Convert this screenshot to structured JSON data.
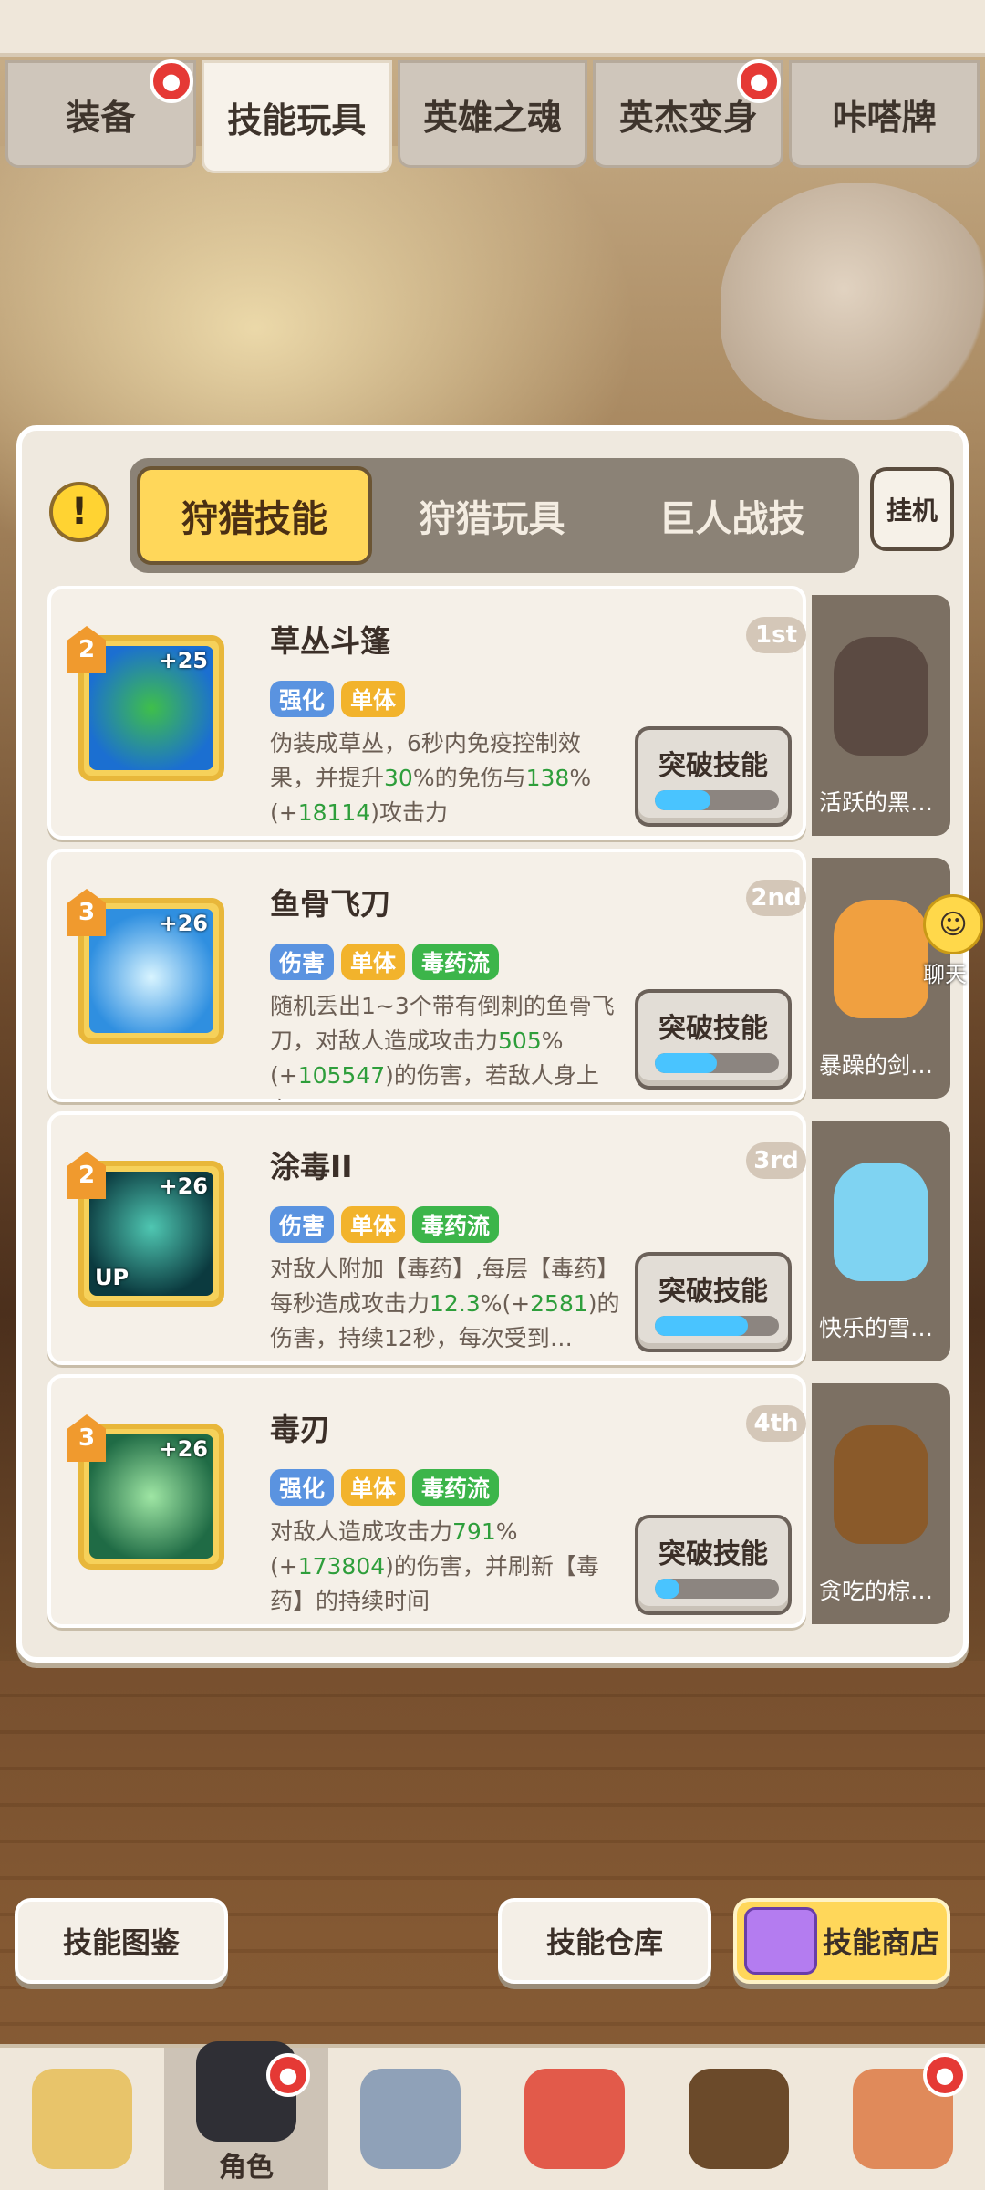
{
  "top_tabs": [
    {
      "label": "装备",
      "badge": true
    },
    {
      "label": "技能玩具",
      "badge": false,
      "active": true
    },
    {
      "label": "英雄之魂",
      "badge": false
    },
    {
      "label": "英杰变身",
      "badge": true
    },
    {
      "label": "咔嗒牌",
      "badge": false
    }
  ],
  "sub_tabs": [
    {
      "label": "狩猎技能",
      "active": true
    },
    {
      "label": "狩猎玩具"
    },
    {
      "label": "巨人战技"
    }
  ],
  "idle_label": "挂机",
  "info_symbol": "!",
  "break_label": "突破技能",
  "skills": [
    {
      "name": "草丛斗篷",
      "rank": "1st",
      "level": "2",
      "plus": "+25",
      "up": "",
      "icon": "bush-icon",
      "tags": [
        {
          "text": "强化",
          "color": "blue"
        },
        {
          "text": "单体",
          "color": "gold"
        }
      ],
      "desc_parts": [
        "伪装成草丛，6秒内免疫控制效果，并提升",
        "30",
        "%的免伤与",
        "138",
        "%(+",
        "18114",
        ")攻击力"
      ],
      "progress": 0.45,
      "companion": "活跃的黑…"
    },
    {
      "name": "鱼骨飞刀",
      "rank": "2nd",
      "level": "3",
      "plus": "+26",
      "up": "",
      "icon": "bone-knives-icon",
      "tags": [
        {
          "text": "伤害",
          "color": "blue"
        },
        {
          "text": "单体",
          "color": "gold"
        },
        {
          "text": "毒药流",
          "color": "green"
        }
      ],
      "desc_parts": [
        "随机丢出1~3个带有倒刺的鱼骨飞刀，对敌人造成攻击力",
        "505",
        "%(+",
        "105547",
        ")的伤害，若敌人身上有…"
      ],
      "progress": 0.5,
      "companion": "暴躁的剑…"
    },
    {
      "name": "涂毒II",
      "rank": "3rd",
      "level": "2",
      "plus": "+26",
      "up": "UP",
      "icon": "poison-drop-icon",
      "tags": [
        {
          "text": "伤害",
          "color": "blue"
        },
        {
          "text": "单体",
          "color": "gold"
        },
        {
          "text": "毒药流",
          "color": "green"
        }
      ],
      "desc_parts": [
        "对敌人附加【毒药】,每层【毒药】每秒造成攻击力",
        "12.3",
        "%(+",
        "2581",
        ")的伤害，持续12秒，每次受到…"
      ],
      "progress": 0.75,
      "companion": "快乐的雪…"
    },
    {
      "name": "毒刃",
      "rank": "4th",
      "level": "3",
      "plus": "+26",
      "up": "",
      "icon": "poison-skull-icon",
      "tags": [
        {
          "text": "强化",
          "color": "blue"
        },
        {
          "text": "单体",
          "color": "gold"
        },
        {
          "text": "毒药流",
          "color": "green"
        }
      ],
      "desc_parts": [
        "对敌人造成攻击力",
        "791",
        "%(+",
        "173804",
        ")的伤害，并刷新【毒药】的持续时间"
      ],
      "progress": 0.2,
      "companion": "贪吃的棕…"
    }
  ],
  "chat_label": "聊天",
  "bottom_buttons": {
    "codex": "技能图鉴",
    "storage": "技能仓库",
    "shop": "技能商店"
  },
  "nav": [
    {
      "label": "",
      "icon": "hero-icon"
    },
    {
      "label": "角色",
      "icon": "character-icon",
      "active": true,
      "badge": true
    },
    {
      "label": "",
      "icon": "weapon-icon"
    },
    {
      "label": "",
      "icon": "pet-icon"
    },
    {
      "label": "",
      "icon": "companion-icon"
    },
    {
      "label": "",
      "icon": "totem-icon",
      "badge": true
    }
  ],
  "colors": {
    "accent_gold": "#ffd75a",
    "highlight_green": "#2e9e3b",
    "progress_blue": "#49c4ff",
    "badge_red": "#e53935"
  }
}
